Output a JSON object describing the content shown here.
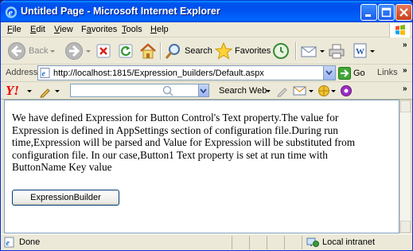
{
  "window": {
    "title": "Untitled Page - Microsoft Internet Explorer"
  },
  "menu": {
    "items": [
      "File",
      "Edit",
      "View",
      "Favorites",
      "Tools",
      "Help"
    ],
    "mnemonics": [
      "F",
      "E",
      "V",
      "a",
      "T",
      "H"
    ]
  },
  "toolbar": {
    "back_label": "Back",
    "search_label": "Search",
    "favorites_label": "Favorites"
  },
  "address": {
    "label": "Address",
    "url": "http://localhost:1815/Expression_builders/Default.aspx",
    "go_label": "Go",
    "links_label": "Links"
  },
  "yahoo": {
    "logo": "Y!",
    "search_value": "",
    "search_web_label": "Search Web"
  },
  "content": {
    "paragraph": "We have defined Expression for Button Control's Text property.The value for Expression is defined in AppSettings section of configuration file.During run time,Expression will be parsed and Value for Expression will be substituted from configuration file. In our case,Button1 Text property is set at run time with ButtonName Key value",
    "button_label": "ExpressionBuilder"
  },
  "status": {
    "text": "Done",
    "zone": "Local intranet"
  },
  "colors": {
    "titlebar": "#0053ee",
    "chrome": "#ece9d8",
    "yahoo_red": "#e00000"
  },
  "icons": [
    "ie-icon",
    "minimize-icon",
    "maximize-icon",
    "close-icon",
    "windows-logo-icon",
    "back-arrow-icon",
    "forward-arrow-icon",
    "stop-icon",
    "refresh-icon",
    "home-icon",
    "search-icon",
    "favorites-star-icon",
    "history-icon",
    "mail-icon",
    "print-icon",
    "edit-icon",
    "page-icon",
    "go-arrow-icon",
    "pencil-icon",
    "yahoo-search-icon",
    "globe-icon",
    "zone-icon"
  ]
}
